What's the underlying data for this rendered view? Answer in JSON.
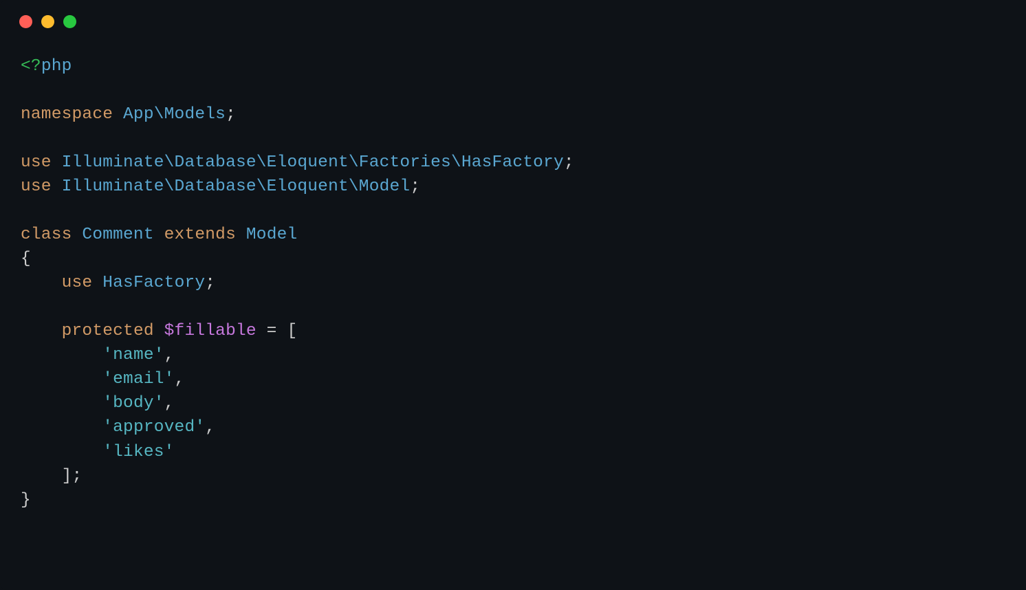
{
  "titlebar": {
    "traffic_lights": {
      "red": "close",
      "yellow": "minimize",
      "green": "maximize"
    }
  },
  "code": {
    "t_php_open": "<?",
    "t_php": "php",
    "t_namespace": "namespace",
    "t_app_models": "App\\Models",
    "t_semi1": ";",
    "t_use1": "use",
    "t_ns1": "Illuminate\\Database\\Eloquent\\Factories\\HasFactory",
    "t_semi2": ";",
    "t_use2": "use",
    "t_ns2": "Illuminate\\Database\\Eloquent\\Model",
    "t_semi3": ";",
    "t_class": "class",
    "t_classname": "Comment",
    "t_extends": "extends",
    "t_model": "Model",
    "t_obrace": "{",
    "t_indent1": "    ",
    "t_indent2": "        ",
    "t_use3": "use",
    "t_hasfactory": "HasFactory",
    "t_semi4": ";",
    "t_protected": "protected",
    "t_fillable": "$fillable",
    "t_eq": " = ",
    "t_obracket": "[",
    "t_s_name": "'name'",
    "t_comma1": ",",
    "t_s_email": "'email'",
    "t_comma2": ",",
    "t_s_body": "'body'",
    "t_comma3": ",",
    "t_s_approved": "'approved'",
    "t_comma4": ",",
    "t_s_likes": "'likes'",
    "t_cbracket": "];",
    "t_cbrace": "}"
  }
}
